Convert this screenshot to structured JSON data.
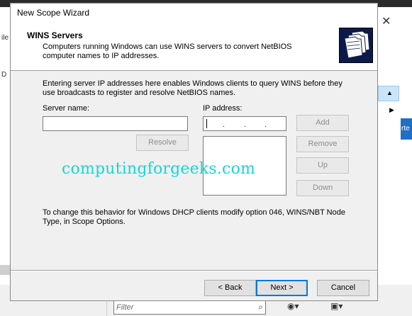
{
  "background": {
    "filter_placeholder": "Filter",
    "tab_edge_text": "rte",
    "left_labels": [
      "ile",
      "D"
    ],
    "close_glyph": "✕"
  },
  "dialog": {
    "title": "New Scope Wizard",
    "header_title": "WINS Servers",
    "header_desc": "Computers running Windows can use WINS servers to convert NetBIOS computer names to IP addresses.",
    "intro": "Entering server IP addresses here enables Windows clients to query WINS before they use broadcasts to register and resolve NetBIOS names.",
    "server_name_label": "Server name:",
    "server_name_value": "",
    "ip_address_label": "IP address:",
    "buttons": {
      "resolve": "Resolve",
      "add": "Add",
      "remove": "Remove",
      "up": "Up",
      "down": "Down",
      "back": "< Back",
      "next": "Next >",
      "cancel": "Cancel"
    },
    "note": "To change this behavior for Windows DHCP clients modify option 046, WINS/NBT Node Type, in Scope Options.",
    "icon": "folder-stack-icon"
  },
  "watermark": "computingforgeeks.com"
}
